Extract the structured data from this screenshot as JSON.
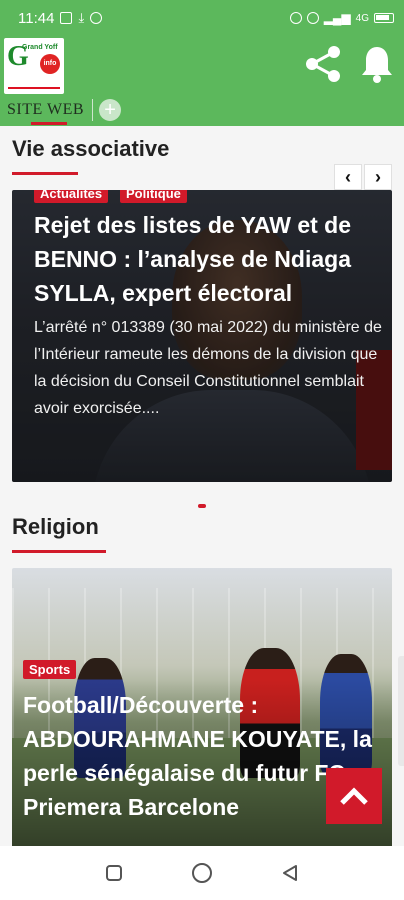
{
  "status_bar": {
    "time": "11:44",
    "battery_label": "4G"
  },
  "app_bar": {
    "logo_text": "Grand Yoff",
    "logo_badge": "info",
    "tab_label": "SITE WEB",
    "add_tab_symbol": "+"
  },
  "sections": {
    "vie_associative": {
      "title": "Vie associative",
      "card": {
        "tags": [
          "Actualites",
          "Politique"
        ],
        "title": "Rejet des listes de YAW et de BENNO : l’analyse de Ndiaga SYLLA, expert électoral",
        "excerpt": "L’arrêté n° 013389 (30 mai 2022) du ministère de l’Intérieur rameute les démons de la division que la décision du Conseil Constitutionnel semblait avoir exorcisée...."
      },
      "prev_symbol": "‹",
      "next_symbol": "›"
    },
    "religion": {
      "title": "Religion",
      "card": {
        "tag": "Sports",
        "title": "Football/Découverte : ABDOURAHMANE KOUYATE, la perle sénégalaise du futur FC Priemera Barcelone"
      }
    }
  },
  "colors": {
    "brand_green": "#5cb85c",
    "accent_red": "#d11a2a"
  },
  "icons": [
    "share-icon",
    "bell-icon",
    "chevron-left-icon",
    "chevron-right-icon",
    "chevron-up-icon",
    "nav-recents-icon",
    "nav-home-icon",
    "nav-back-icon"
  ]
}
